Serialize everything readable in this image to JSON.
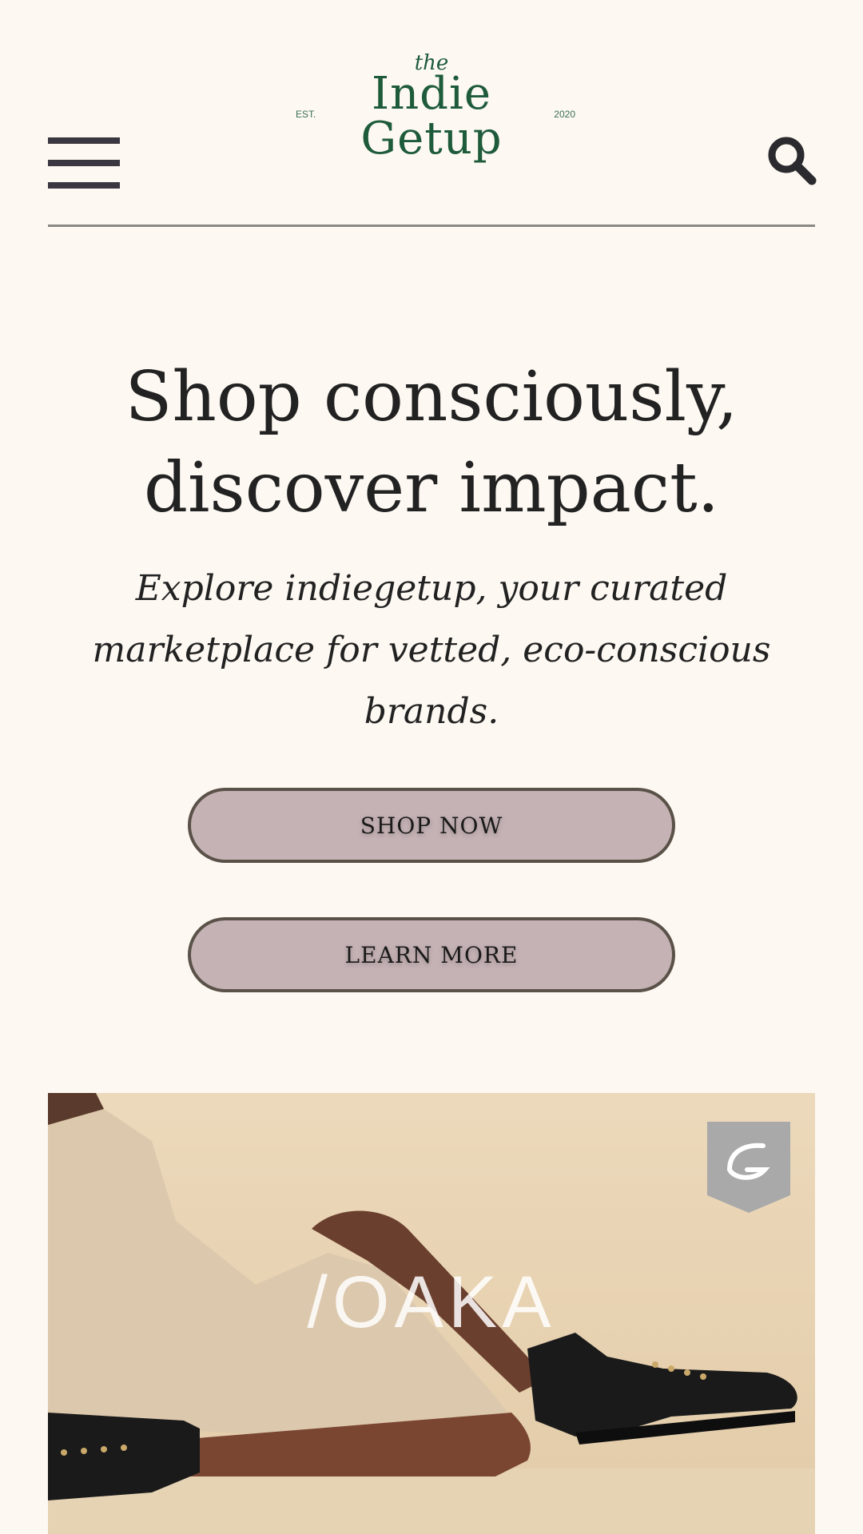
{
  "header": {
    "menu_icon": "hamburger-icon",
    "search_icon": "search-icon",
    "logo": {
      "the": "the",
      "name_line1": "Indie",
      "name_line2": "Getup",
      "est": "EST.",
      "year": "2020",
      "color": "#1e5b3b"
    }
  },
  "hero": {
    "title_line1": "Shop consciously,",
    "title_line2": "discover impact.",
    "subtitle": "Explore indiegetup, your curated marketplace for vetted, eco-conscious brands.",
    "shop_now_label": "SHOP NOW",
    "learn_more_label": "LEARN MORE",
    "button_color": "#c5b2b4"
  },
  "feature": {
    "brand_text": "/OAKA",
    "badge_icon": "brand-badge-icon",
    "background_color": "#e8d3b3"
  }
}
